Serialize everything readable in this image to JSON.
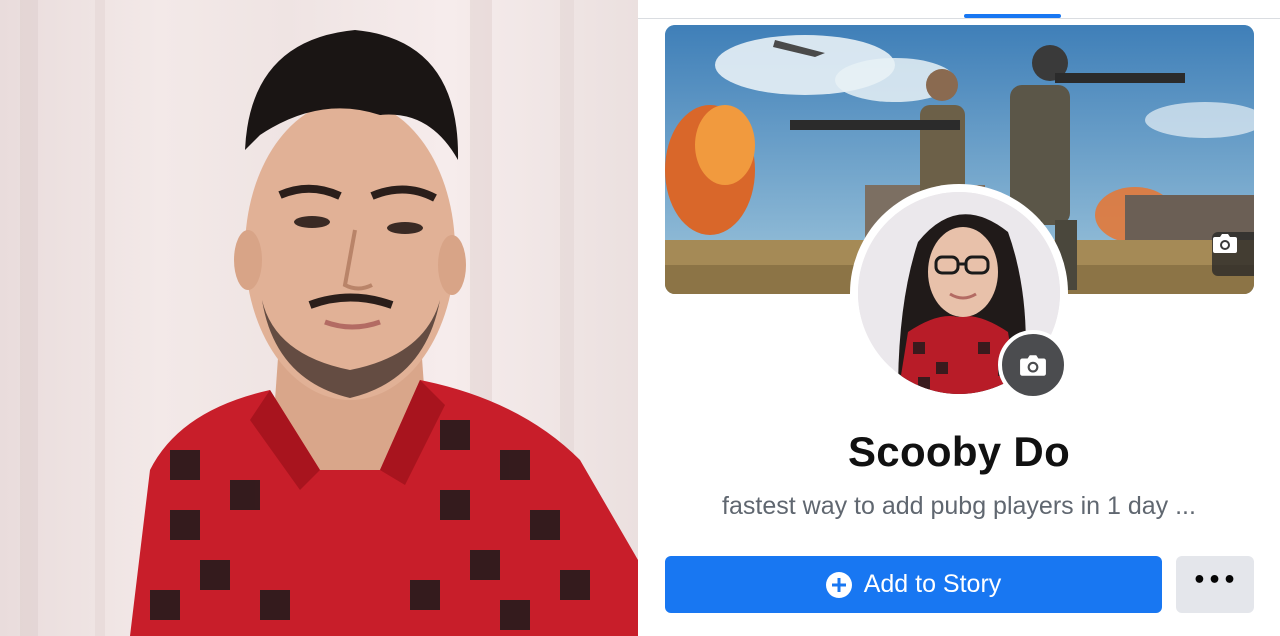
{
  "profile": {
    "name": "Scooby Do",
    "bio": "fastest way to add pubg players in 1 day ...",
    "cover_camera_icon": "camera-icon",
    "avatar_camera_icon": "camera-icon"
  },
  "actions": {
    "add_story_label": "Add to Story",
    "add_story_icon": "plus-circle-icon",
    "more_icon": "more-horizontal-icon",
    "more_label": "•••"
  },
  "colors": {
    "accent": "#1877f2",
    "secondary_button": "#e4e6eb",
    "name_text": "#111111",
    "bio_text": "#606770"
  }
}
